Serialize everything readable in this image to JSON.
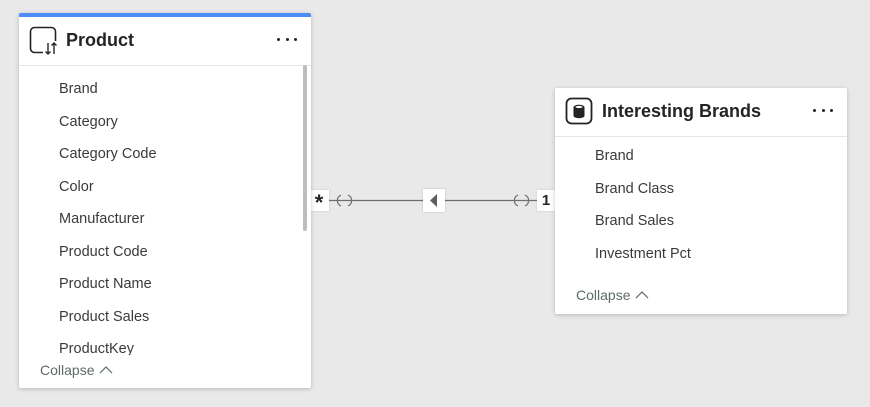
{
  "product_table": {
    "title": "Product",
    "icon": "table-hierarchy-icon",
    "fields": [
      "Brand",
      "Category",
      "Category Code",
      "Color",
      "Manufacturer",
      "Product Code",
      "Product Name",
      "Product Sales",
      "ProductKey"
    ],
    "collapse_label": "Collapse",
    "accent_color": "#4f8df6"
  },
  "brands_table": {
    "title": "Interesting Brands",
    "icon": "database-icon",
    "fields": [
      "Brand",
      "Brand Class",
      "Brand Sales",
      "Investment Pct"
    ],
    "collapse_label": "Collapse"
  },
  "relationship": {
    "from_cardinality": "*",
    "to_cardinality": "1",
    "direction": "single-left"
  }
}
